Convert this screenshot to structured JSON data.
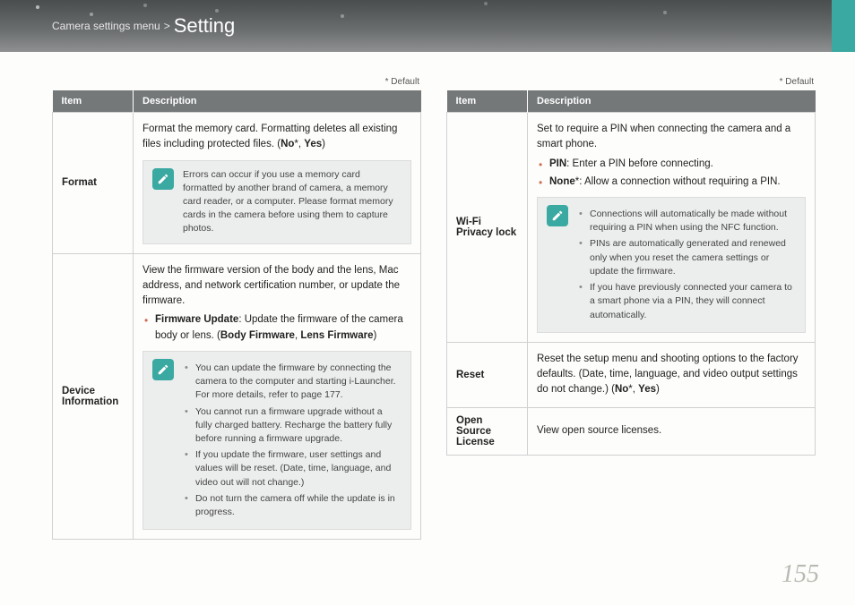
{
  "header": {
    "pre": "Camera settings menu",
    "sep": ">",
    "title": "Setting"
  },
  "defaultNote": "* Default",
  "tableHeaders": {
    "item": "Item",
    "desc": "Description"
  },
  "left": {
    "format": {
      "label": "Format",
      "intro_a": "Format the memory card. Formatting deletes all existing files including protected files. (",
      "no": "No",
      "sep": "*, ",
      "yes": "Yes",
      "close": ")",
      "note": "Errors can occur if you use a memory card formatted by another brand of camera, a memory card reader, or a computer. Please format memory cards in the camera before using them to capture photos."
    },
    "device": {
      "label": "Device Information",
      "intro": "View the firmware version of the body and the lens, Mac address, and network certification number, or update the firmware.",
      "fw_a": "Firmware Update",
      "fw_b": ": Update the firmware of the camera body or lens. (",
      "fw_c": "Body Firmware",
      "fw_d": ", ",
      "fw_e": "Lens Firmware",
      "fw_f": ")",
      "notes": {
        "n1": "You can update the firmware by connecting the camera to the computer and starting i-Launcher. For more details, refer to page 177.",
        "n2": "You cannot run a firmware upgrade without a fully charged battery. Recharge the battery fully before running a firmware upgrade.",
        "n3": "If you update the firmware, user settings and values will be reset. (Date, time, language, and video out will not change.)",
        "n4": "Do not turn the camera off while the update is in progress."
      }
    }
  },
  "right": {
    "wifi": {
      "label": "Wi-Fi Privacy lock",
      "intro": "Set to require a PIN when connecting the camera and a smart phone.",
      "pin_a": "PIN",
      "pin_b": ": Enter a PIN before connecting.",
      "none_a": "None",
      "none_b": "*: Allow a connection without requiring a PIN.",
      "notes": {
        "n1": "Connections will automatically be made without requiring a PIN when using the NFC function.",
        "n2": "PINs are automatically generated and renewed only when you reset the camera settings or update the firmware.",
        "n3": "If you have previously connected your camera to a smart phone via a PIN, they will connect automatically."
      }
    },
    "reset": {
      "label": "Reset",
      "intro_a": "Reset the setup menu and shooting options to the factory defaults. (Date, time, language, and video output settings do not change.) (",
      "no": "No",
      "sep": "*, ",
      "yes": "Yes",
      "close": ")"
    },
    "osl": {
      "label": "Open Source License",
      "desc": "View open source licenses."
    }
  },
  "pageNumber": "155"
}
